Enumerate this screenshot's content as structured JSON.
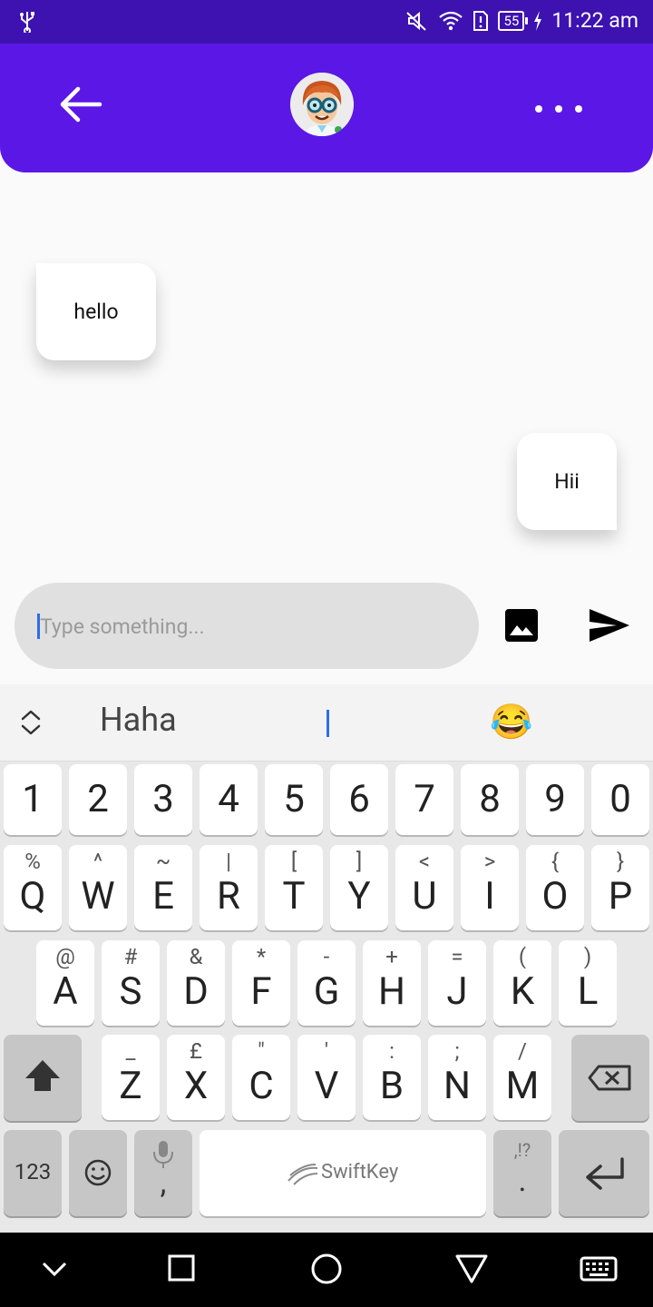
{
  "status_bar": {
    "battery": "55",
    "time": "11:22 am"
  },
  "messages": [
    {
      "side": "left",
      "text": "hello"
    },
    {
      "side": "right",
      "text": "Hii"
    }
  ],
  "composer": {
    "placeholder": "Type something..."
  },
  "keyboard": {
    "suggestion_word": "Haha",
    "suggestion_emoji": "😂",
    "number_row": [
      "1",
      "2",
      "3",
      "4",
      "5",
      "6",
      "7",
      "8",
      "9",
      "0"
    ],
    "row1": [
      {
        "main": "Q",
        "sub": "%"
      },
      {
        "main": "W",
        "sub": "^"
      },
      {
        "main": "E",
        "sub": "~"
      },
      {
        "main": "R",
        "sub": "|"
      },
      {
        "main": "T",
        "sub": "["
      },
      {
        "main": "Y",
        "sub": "]"
      },
      {
        "main": "U",
        "sub": "<"
      },
      {
        "main": "I",
        "sub": ">"
      },
      {
        "main": "O",
        "sub": "{"
      },
      {
        "main": "P",
        "sub": "}"
      }
    ],
    "row2": [
      {
        "main": "A",
        "sub": "@"
      },
      {
        "main": "S",
        "sub": "#"
      },
      {
        "main": "D",
        "sub": "&"
      },
      {
        "main": "F",
        "sub": "*"
      },
      {
        "main": "G",
        "sub": "-"
      },
      {
        "main": "H",
        "sub": "+"
      },
      {
        "main": "J",
        "sub": "="
      },
      {
        "main": "K",
        "sub": "("
      },
      {
        "main": "L",
        "sub": ")"
      }
    ],
    "row3": [
      {
        "main": "Z",
        "sub": "_"
      },
      {
        "main": "X",
        "sub": "£"
      },
      {
        "main": "C",
        "sub": "\""
      },
      {
        "main": "V",
        "sub": "'"
      },
      {
        "main": "B",
        "sub": ":"
      },
      {
        "main": "N",
        "sub": ";"
      },
      {
        "main": "M",
        "sub": "/"
      }
    ],
    "key_123": "123",
    "key_comma": ",",
    "key_period": ".",
    "key_period_sub": ",!?",
    "space_label": "SwiftKey"
  }
}
